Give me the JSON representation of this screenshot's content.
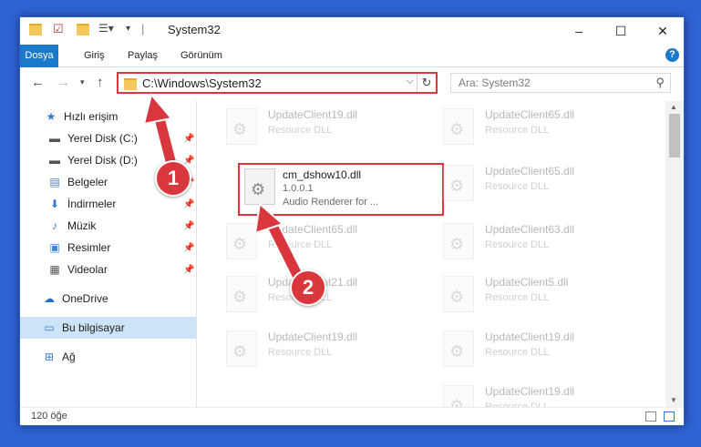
{
  "window": {
    "title": "System32",
    "controls": {
      "minimize": "–",
      "maximize": "☐",
      "close": "✕"
    }
  },
  "ribbon": {
    "tabs": [
      "Dosya",
      "Giriş",
      "Paylaş",
      "Görünüm"
    ],
    "help": "?"
  },
  "address": {
    "path": "C:\\Windows\\System32",
    "search_placeholder": "Ara: System32"
  },
  "sidebar": {
    "quick_access": "Hızlı erişim",
    "items": [
      {
        "label": "Yerel Disk (C:)",
        "icon": "drive-icon",
        "pinned": true
      },
      {
        "label": "Yerel Disk (D:)",
        "icon": "drive-icon",
        "pinned": true
      },
      {
        "label": "Belgeler",
        "icon": "documents-icon",
        "pinned": true
      },
      {
        "label": "İndirmeler",
        "icon": "downloads-icon",
        "pinned": true
      },
      {
        "label": "Müzik",
        "icon": "music-icon",
        "pinned": true
      },
      {
        "label": "Resimler",
        "icon": "pictures-icon",
        "pinned": true
      },
      {
        "label": "Videolar",
        "icon": "videos-icon",
        "pinned": true
      }
    ],
    "onedrive": "OneDrive",
    "this_pc": "Bu bilgisayar",
    "network": "Ağ"
  },
  "files": {
    "left": [
      {
        "name": "UpdateClient19.dll",
        "type": "Resource DLL"
      },
      {
        "name": "cm_dshow10.dll",
        "type": "1.0.0.1",
        "desc": "Audio Renderer for ..."
      },
      {
        "name": "UpdateClient65.dll",
        "type": "Resource DLL"
      },
      {
        "name": "UpdateClient21.dll",
        "type": "Resource DLL"
      },
      {
        "name": "UpdateClient19.dll",
        "type": "Resource DLL"
      }
    ],
    "right": [
      {
        "name": "UpdateClient65.dll",
        "type": "Resource DLL"
      },
      {
        "name": "UpdateClient65.dll",
        "type": "Resource DLL"
      },
      {
        "name": "UpdateClient63.dll",
        "type": "Resource DLL"
      },
      {
        "name": "UpdateClient5.dll",
        "type": "Resource DLL"
      },
      {
        "name": "UpdateClient19.dll",
        "type": "Resource DLL"
      },
      {
        "name": "UpdateClient19.dll",
        "type": "Resource DLL"
      }
    ]
  },
  "status": {
    "count": "120 öğe"
  },
  "annotations": {
    "step1": "1",
    "step2": "2",
    "color": "#d9363e"
  }
}
